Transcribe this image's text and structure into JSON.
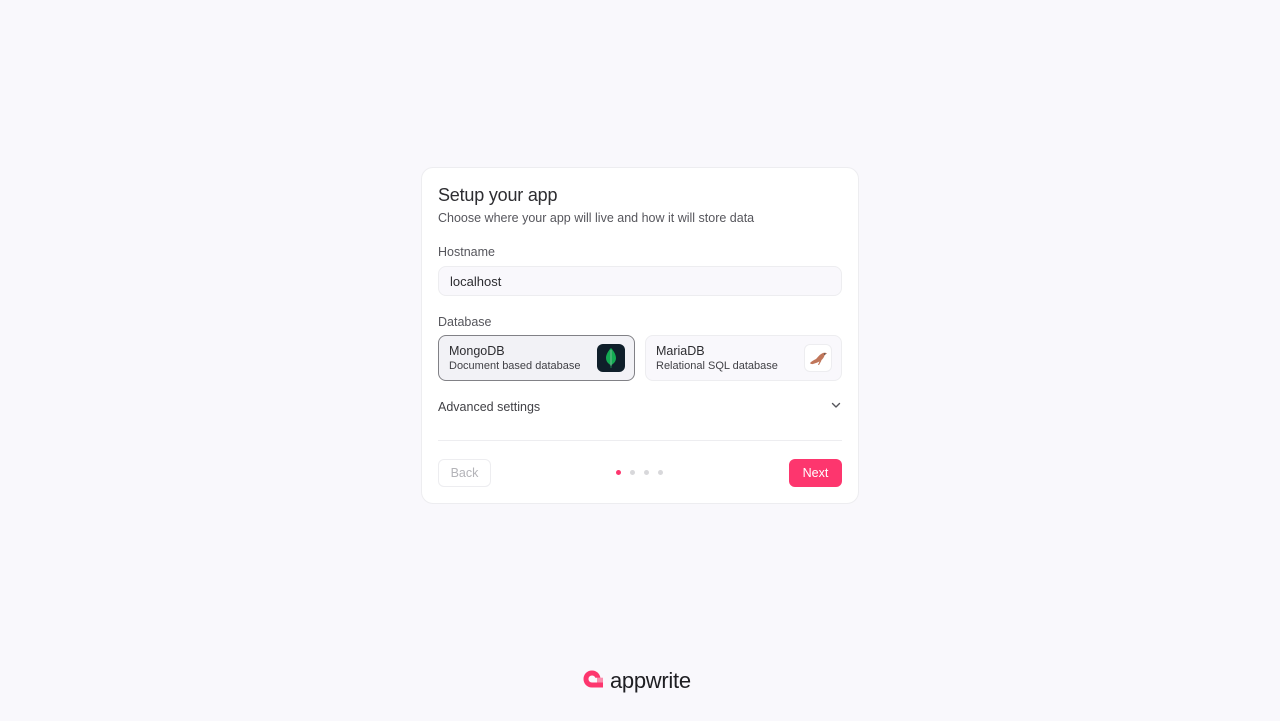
{
  "setup": {
    "title": "Setup your app",
    "subtitle": "Choose where your app will live and how it will store data",
    "hostname_label": "Hostname",
    "hostname_value": "localhost",
    "database_label": "Database",
    "databases": [
      {
        "name": "MongoDB",
        "description": "Document based database",
        "icon": "mongodb-leaf-icon",
        "selected": true
      },
      {
        "name": "MariaDB",
        "description": "Relational SQL database",
        "icon": "mariadb-seal-icon",
        "selected": false
      }
    ],
    "advanced_label": "Advanced settings",
    "back_label": "Back",
    "next_label": "Next",
    "steps_total": 4,
    "current_step": 1
  },
  "brand": {
    "name": "appwrite",
    "accent": "#fd366e"
  }
}
